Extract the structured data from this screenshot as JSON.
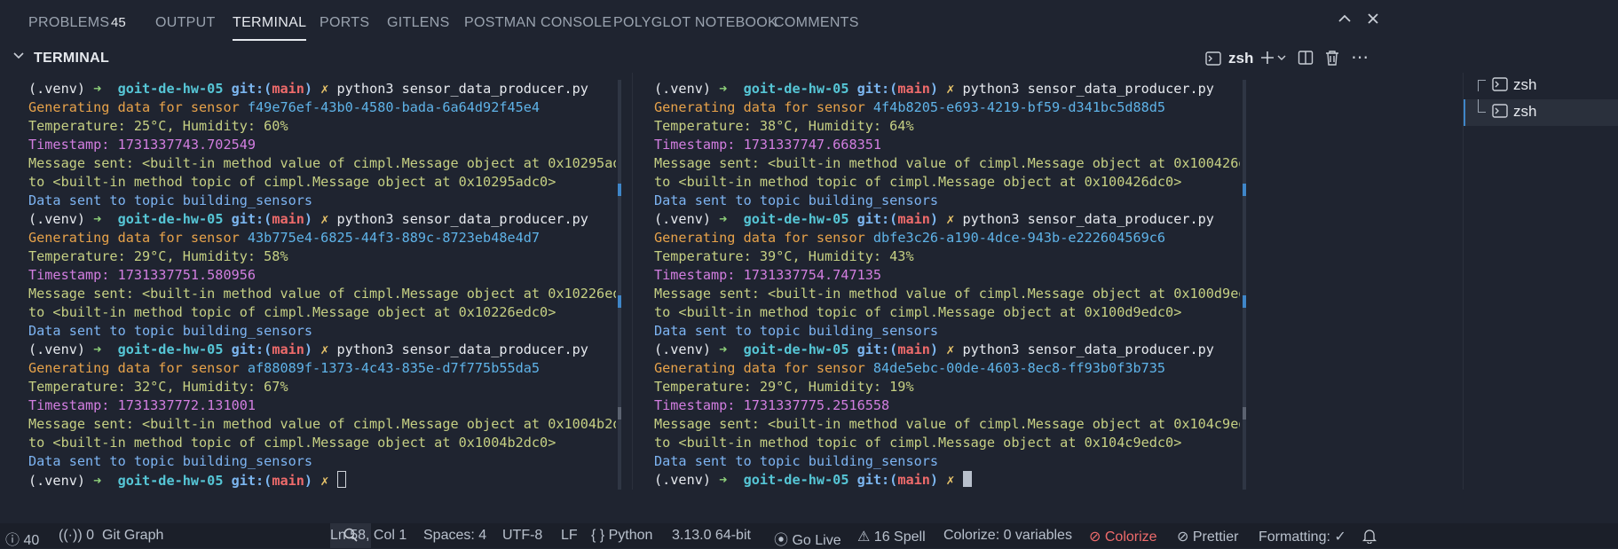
{
  "tabs": [
    {
      "label": "PROBLEMS"
    },
    {
      "label": "OUTPUT"
    },
    {
      "label": "TERMINAL"
    },
    {
      "label": "PORTS"
    },
    {
      "label": "GITLENS"
    },
    {
      "label": "POSTMAN CONSOLE"
    },
    {
      "label": "POLYGLOT NOTEBOOK"
    },
    {
      "label": "COMMENTS"
    }
  ],
  "problems_count": "45",
  "terminal_header": {
    "title": "TERMINAL",
    "shell": "zsh"
  },
  "prompt": {
    "venv": "(.venv)",
    "arrow": "➜",
    "dir": "goit-de-hw-05",
    "git": "git:(",
    "branch": "main",
    "git_close": ")",
    "dirty": "✗",
    "cmd": "python3 sensor_data_producer.py"
  },
  "text": {
    "generating": "Generating data for sensor",
    "temp_prefix": "Temperature: ",
    "hum_prefix": "°C, Humidity: ",
    "pct": "%",
    "ts_prefix": "Timestamp: ",
    "msg_prefix": "Message sent: <built-in method value of cimpl.Message object at ",
    "msg_to": "to <built-in method topic of cimpl.Message object at ",
    "data_sent": "Data sent to topic building_sensors"
  },
  "left_runs": [
    {
      "sensor": "f49e76ef-43b0-4580-bada-6a64d92f45e4",
      "temp": "25",
      "hum": "60",
      "ts": "1731337743.702549",
      "addr": "0x10295adc0"
    },
    {
      "sensor": "43b775e4-6825-44f3-889c-8723eb48e4d7",
      "temp": "29",
      "hum": "58",
      "ts": "1731337751.580956",
      "addr": "0x10226edc0"
    },
    {
      "sensor": "af88089f-1373-4c43-835e-d7f775b55da5",
      "temp": "32",
      "hum": "67",
      "ts": "1731337772.131001",
      "addr": "0x1004b2dc0"
    }
  ],
  "right_runs": [
    {
      "sensor": "4f4b8205-e693-4219-bf59-d341bc5d88d5",
      "temp": "38",
      "hum": "64",
      "ts": "1731337747.668351",
      "addr": "0x100426dc0"
    },
    {
      "sensor": "dbfe3c26-a190-4dce-943b-e222604569c6",
      "temp": "39",
      "hum": "43",
      "ts": "1731337754.747135",
      "addr": "0x100d9edc0"
    },
    {
      "sensor": "84de5ebc-00de-4603-8ec8-ff93b0f3b735",
      "temp": "29",
      "hum": "19",
      "ts": "1731337775.2516558",
      "addr": "0x104c9edc0"
    }
  ],
  "terminal_list": [
    {
      "label": "zsh"
    },
    {
      "label": "zsh"
    }
  ],
  "status_bar": {
    "errors": "40",
    "ports": "0",
    "git_graph": "Git Graph",
    "position": "Ln 58, Col 1",
    "spaces": "Spaces: 4",
    "encoding": "UTF-8",
    "eol": "LF",
    "language": "Python",
    "interpreter": "3.13.0 64-bit",
    "go_live": "Go Live",
    "spell": "16 Spell",
    "colorize_vars": "Colorize: 0 variables",
    "colorize": "Colorize",
    "prettier": "Prettier",
    "formatting": "Formatting: ✓"
  },
  "colors": {
    "accent": "#3f86c8",
    "background": "#1f2430",
    "statusbar": "#1b1f29"
  },
  "icons": [
    "chevron-up-icon",
    "close-icon",
    "chevron-down-icon",
    "terminal-icon",
    "plus-icon",
    "split-icon",
    "trash-icon",
    "more-icon",
    "bell-icon",
    "search-icon"
  ]
}
